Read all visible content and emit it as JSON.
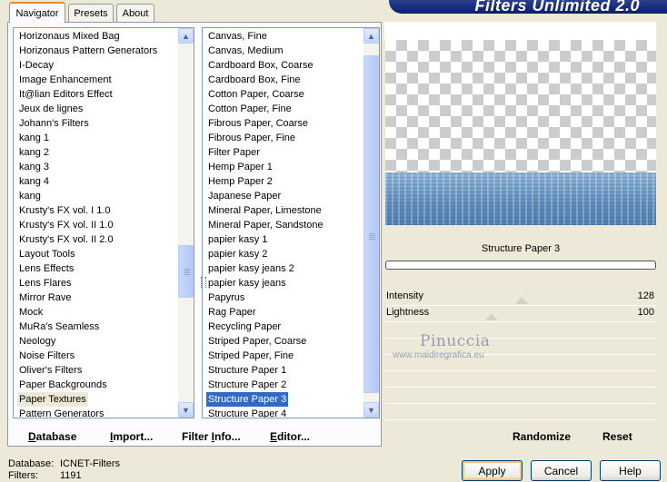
{
  "banner": {
    "title": "Filters Unlimited 2.0"
  },
  "tabs": [
    {
      "label": "Navigator",
      "active": true
    },
    {
      "label": "Presets",
      "active": false
    },
    {
      "label": "About",
      "active": false
    }
  ],
  "categories": {
    "items": [
      "Horizonaus Mixed Bag",
      "Horizonaus Pattern Generators",
      "I-Decay",
      "Image Enhancement",
      "It@lian Editors Effect",
      "Jeux de lignes",
      "Johann's Filters",
      "kang 1",
      "kang 2",
      "kang 3",
      "kang 4",
      "kang",
      "Krusty's FX vol. I 1.0",
      "Krusty's FX vol. II 1.0",
      "Krusty's FX vol. II 2.0",
      "Layout Tools",
      "Lens Effects",
      "Lens Flares",
      "Mirror Rave",
      "Mock",
      "MuRa's Seamless",
      "Neology",
      "Noise Filters",
      "Oliver's Filters",
      "Paper Backgrounds",
      "Paper Textures",
      "Pattern Generators"
    ],
    "selected": "Paper Textures"
  },
  "filters": {
    "items": [
      "Canvas, Fine",
      "Canvas, Medium",
      "Cardboard Box, Coarse",
      "Cardboard Box, Fine",
      "Cotton Paper, Coarse",
      "Cotton Paper, Fine",
      "Fibrous Paper, Coarse",
      "Fibrous Paper, Fine",
      "Filter Paper",
      "Hemp Paper 1",
      "Hemp Paper 2",
      "Japanese Paper",
      "Mineral Paper, Limestone",
      "Mineral Paper, Sandstone",
      "papier kasy 1",
      "papier kasy 2",
      "papier kasy jeans 2",
      "papier kasy jeans",
      "Papyrus",
      "Rag Paper",
      "Recycling Paper",
      "Striped Paper, Coarse",
      "Striped Paper, Fine",
      "Structure Paper 1",
      "Structure Paper 2",
      "Structure Paper 3",
      "Structure Paper 4"
    ],
    "selected": "Structure Paper 3"
  },
  "left_commands": {
    "database": {
      "prefix": "",
      "accel": "D",
      "suffix": "atabase"
    },
    "import": {
      "prefix": "",
      "accel": "I",
      "suffix": "mport..."
    },
    "filter_info": {
      "prefix": "Filter ",
      "accel": "I",
      "suffix": "nfo..."
    },
    "editor": {
      "prefix": "",
      "accel": "E",
      "suffix": "ditor..."
    }
  },
  "preview": {
    "filter_name": "Structure Paper 3"
  },
  "params": [
    {
      "label": "Intensity",
      "value": "128",
      "level": 0.502
    },
    {
      "label": "Lightness",
      "value": "100",
      "level": 0.392
    }
  ],
  "watermark": {
    "name": "Pinuccia",
    "url": "www.maidiregrafica.eu"
  },
  "right_commands": {
    "randomize": "Randomize",
    "reset": "Reset"
  },
  "status": {
    "database_label": "Database:",
    "database_value": "ICNET-Filters",
    "filters_label": "Filters:",
    "filters_value": "1191"
  },
  "buttons": {
    "apply": "Apply",
    "cancel": "Cancel",
    "help": "Help"
  },
  "colors": {
    "selection": "#316AC5",
    "banner": "#0A1E6E",
    "face": "#ECE9D8"
  }
}
